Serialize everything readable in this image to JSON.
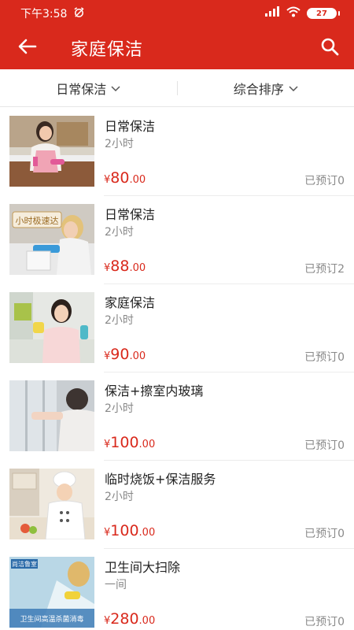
{
  "status_bar": {
    "time": "下午3:58",
    "battery": "27"
  },
  "header": {
    "title": "家庭保洁"
  },
  "filters": {
    "category": "日常保洁",
    "sort": "综合排序"
  },
  "services": [
    {
      "title": "日常保洁",
      "unit": "2小时",
      "currency": "¥",
      "price_int": "80",
      "price_dec": ".00",
      "booked": "已预订0"
    },
    {
      "title": "日常保洁",
      "unit": "2小时",
      "currency": "¥",
      "price_int": "88",
      "price_dec": ".00",
      "booked": "已预订2"
    },
    {
      "title": "家庭保洁",
      "unit": "2小时",
      "currency": "¥",
      "price_int": "90",
      "price_dec": ".00",
      "booked": "已预订0"
    },
    {
      "title": "保洁+擦室内玻璃",
      "unit": "2小时",
      "currency": "¥",
      "price_int": "100",
      "price_dec": ".00",
      "booked": "已预订0"
    },
    {
      "title": " 临时烧饭+保洁服务",
      "unit": "2小时",
      "currency": "¥",
      "price_int": "100",
      "price_dec": ".00",
      "booked": "已预订0"
    },
    {
      "title": "卫生间大扫除",
      "unit": "一间",
      "currency": "¥",
      "price_int": "280",
      "price_dec": ".00",
      "booked": "已预订0"
    }
  ],
  "thumb_texts": {
    "express_badge": "小时极速达",
    "bathroom_banner": "卫生间高温杀菌消毒",
    "brand": "尚洁鲁室"
  },
  "colors": {
    "brand_red": "#d9291c",
    "price_red": "#d9291c",
    "muted_gray": "#8a8a8a"
  },
  "icons": {
    "back": "arrow-left-icon",
    "search": "search-icon",
    "dropdown": "chevron-down-icon",
    "signal": "signal-icon",
    "wifi": "wifi-icon",
    "alarm": "alarm-off-icon"
  }
}
